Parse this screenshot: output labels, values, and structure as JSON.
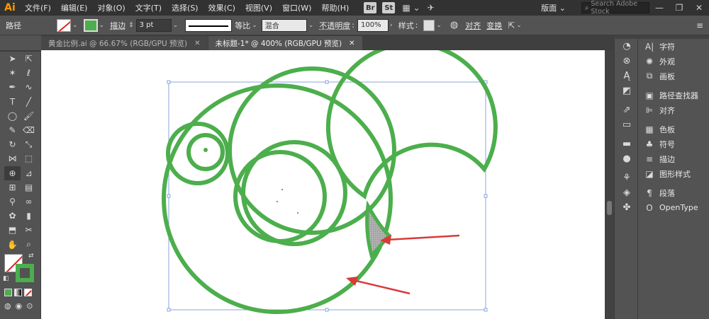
{
  "app": {
    "logo": "Ai",
    "menu": [
      "文件(F)",
      "编辑(E)",
      "对象(O)",
      "文字(T)",
      "选择(S)",
      "效果(C)",
      "视图(V)",
      "窗口(W)",
      "帮助(H)"
    ],
    "bridge": "Br",
    "stock": "St",
    "workspace": "版面",
    "search_placeholder": "Search Adobe Stock",
    "win_min": "—",
    "win_max": "❐",
    "win_close": "✕"
  },
  "control_bar": {
    "object_type": "路径",
    "stroke_label": "描边",
    "stroke_weight": "3 pt",
    "profile": "等比",
    "blend_mode": "混合",
    "opacity_label": "不透明度",
    "opacity_value": "100%",
    "style_label": "样式",
    "align_label": "对齐",
    "transform_label": "变换"
  },
  "tabs": [
    {
      "label": "黄金比例.ai @ 66.67% (RGB/GPU 预览)",
      "close": "✕"
    },
    {
      "label": "未标题-1* @ 400% (RGB/GPU 预览)",
      "close": "✕"
    }
  ],
  "right_panel": [
    {
      "icon": "A|",
      "label": "字符"
    },
    {
      "icon": "✺",
      "label": "外观"
    },
    {
      "icon": "⧉",
      "label": "画板"
    },
    {
      "icon": "▣",
      "label": "路径查找器"
    },
    {
      "icon": "⊫",
      "label": "对齐"
    },
    {
      "icon": "▦",
      "label": "色板"
    },
    {
      "icon": "♣",
      "label": "符号"
    },
    {
      "icon": "≡",
      "label": "描边"
    },
    {
      "icon": "◪",
      "label": "图形样式"
    },
    {
      "icon": "¶",
      "label": "段落"
    },
    {
      "icon": "O",
      "label": "OpenType"
    }
  ],
  "colors": {
    "stroke_green": "#4cae4c",
    "highlight_red": "#d93a3a",
    "fill_gray": "#a7a7a7"
  }
}
